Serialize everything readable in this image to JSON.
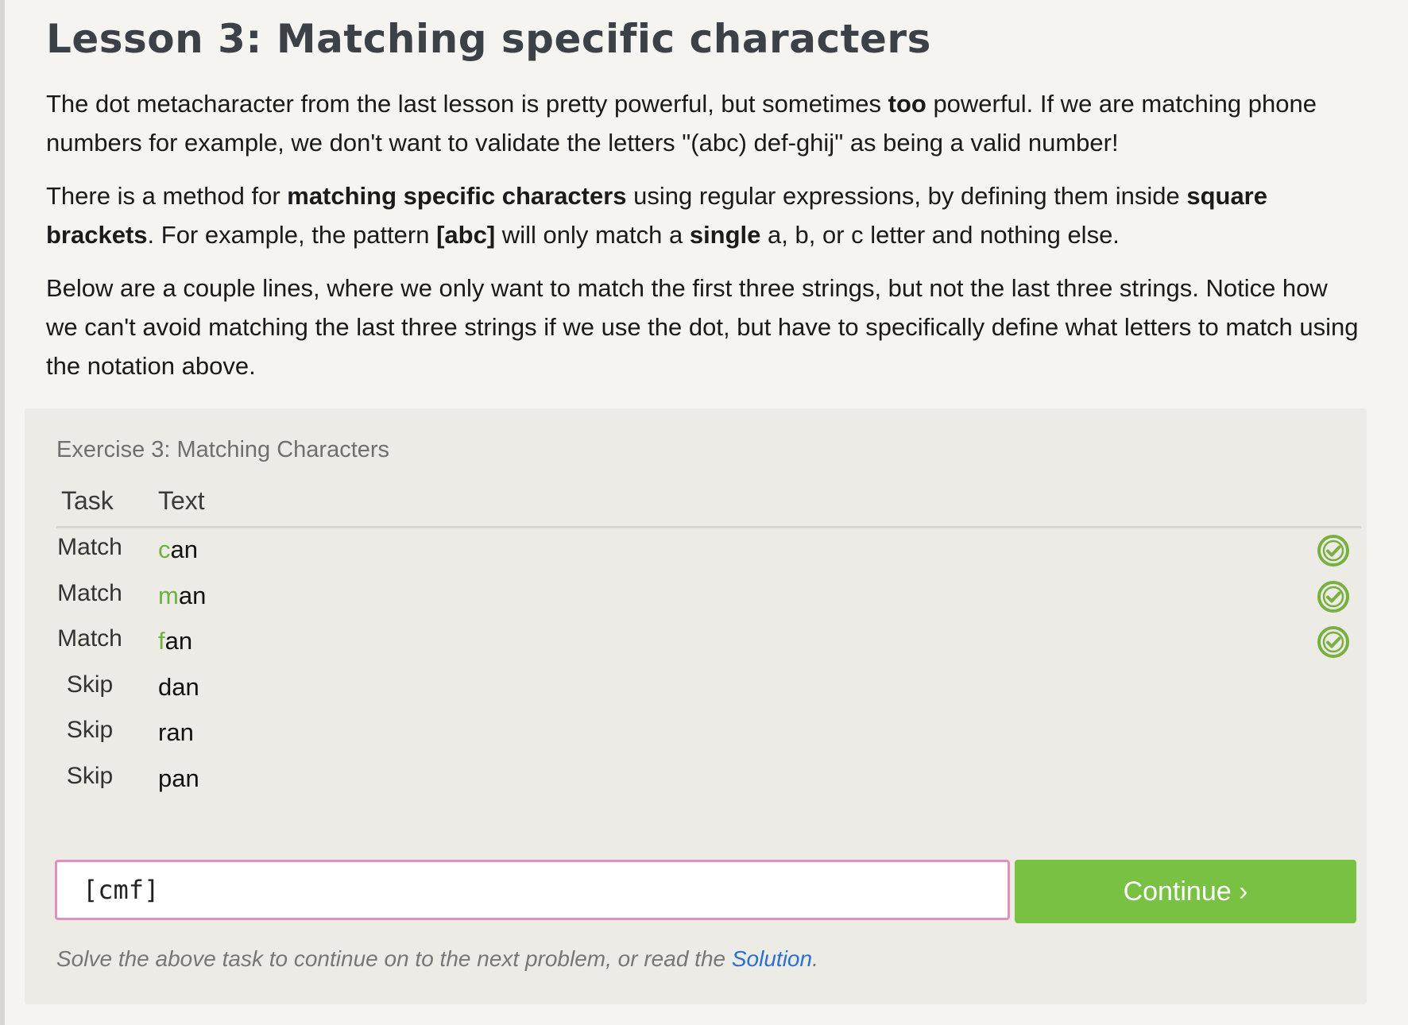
{
  "lesson": {
    "title": "Lesson 3: Matching specific characters",
    "paragraphs": [
      {
        "segments": [
          {
            "text": "The dot metacharacter from the last lesson is pretty powerful, but sometimes ",
            "bold": false
          },
          {
            "text": "too",
            "bold": true
          },
          {
            "text": " powerful. If we are matching phone numbers for example, we don't want to validate the letters \"(abc) def-ghij\" as being a valid number!",
            "bold": false
          }
        ]
      },
      {
        "segments": [
          {
            "text": "There is a method for ",
            "bold": false
          },
          {
            "text": "matching specific characters",
            "bold": true
          },
          {
            "text": " using regular expressions, by defining them inside ",
            "bold": false
          },
          {
            "text": "square brackets",
            "bold": true
          },
          {
            "text": ". For example, the pattern ",
            "bold": false
          },
          {
            "text": "[abc]",
            "bold": true
          },
          {
            "text": " will only match a ",
            "bold": false
          },
          {
            "text": "single",
            "bold": true
          },
          {
            "text": " a, b, or c letter and nothing else.",
            "bold": false
          }
        ]
      },
      {
        "segments": [
          {
            "text": "Below are a couple lines, where we only want to match the first three strings, but not the last three strings. Notice how we can't avoid matching the last three strings if we use the dot, but have to specifically define what letters to match using the notation above.",
            "bold": false
          }
        ]
      }
    ]
  },
  "exercise": {
    "title": "Exercise 3: Matching Characters",
    "headers": {
      "task": "Task",
      "text": "Text"
    },
    "rows": [
      {
        "task": "Match",
        "matched": "c",
        "rest": "an",
        "passed": true
      },
      {
        "task": "Match",
        "matched": "m",
        "rest": "an",
        "passed": true
      },
      {
        "task": "Match",
        "matched": "f",
        "rest": "an",
        "passed": true
      },
      {
        "task": "Skip",
        "matched": "",
        "rest": "dan",
        "passed": false
      },
      {
        "task": "Skip",
        "matched": "",
        "rest": "ran",
        "passed": false
      },
      {
        "task": "Skip",
        "matched": "",
        "rest": "pan",
        "passed": false
      }
    ],
    "input_value": "[cmf]",
    "continue_label": "Continue ›",
    "hint_prefix": "Solve the above task to continue on to the next problem, or read the ",
    "hint_link": "Solution",
    "hint_suffix": ".",
    "colors": {
      "match_highlight": "#6db33f",
      "check": "#78b13f",
      "button": "#78c142",
      "input_border": "#e38fbb",
      "link": "#2a6fd1"
    },
    "check_icon": "check-circle-icon"
  }
}
